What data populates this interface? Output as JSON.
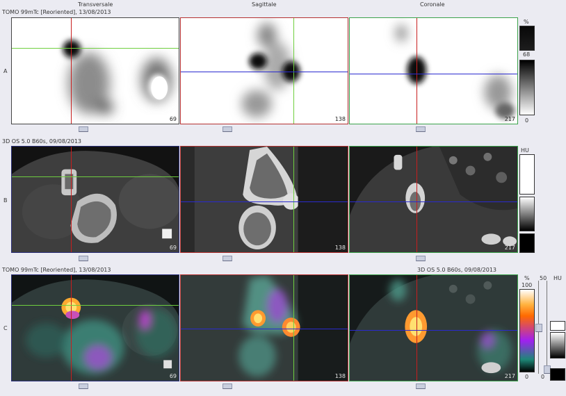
{
  "headers": {
    "col1": "Transversale",
    "col2": "Sagittale",
    "col3": "Coronale"
  },
  "rows": {
    "a": {
      "label": "A",
      "series": "TOMO 99mTc [Reoriented], 13/08/2013"
    },
    "b": {
      "label": "B",
      "series": "3D  OS  5.0  B60s, 09/08/2013"
    },
    "c": {
      "label": "C",
      "series_left": "TOMO 99mTc [Reoriented], 13/08/2013",
      "series_right": "3D  OS  5.0  B60s, 09/08/2013"
    }
  },
  "slices": {
    "a1": "69",
    "a2": "138",
    "a3": "217",
    "b1": "69",
    "b2": "138",
    "b3": "217",
    "c1": "69",
    "c2": "138",
    "c3": "217"
  },
  "scales": {
    "nm": {
      "unit": "%",
      "level": "68",
      "min": "0"
    },
    "ct": {
      "unit": "HU"
    },
    "fusion": {
      "unit_left": "%",
      "max_left": "100",
      "min_left": "0",
      "mid_right": "50",
      "unit_right": "HU",
      "min_right": "0"
    }
  },
  "colors": {
    "background": "#ebebf2",
    "transversal_frame": "#2b2f7a",
    "sagittal_frame": "#b53030",
    "coronal_frame": "#3aa24a",
    "crosshair_red": "#c81e1e",
    "crosshair_green": "#6fcf3f",
    "crosshair_blue": "#2a2acf"
  }
}
